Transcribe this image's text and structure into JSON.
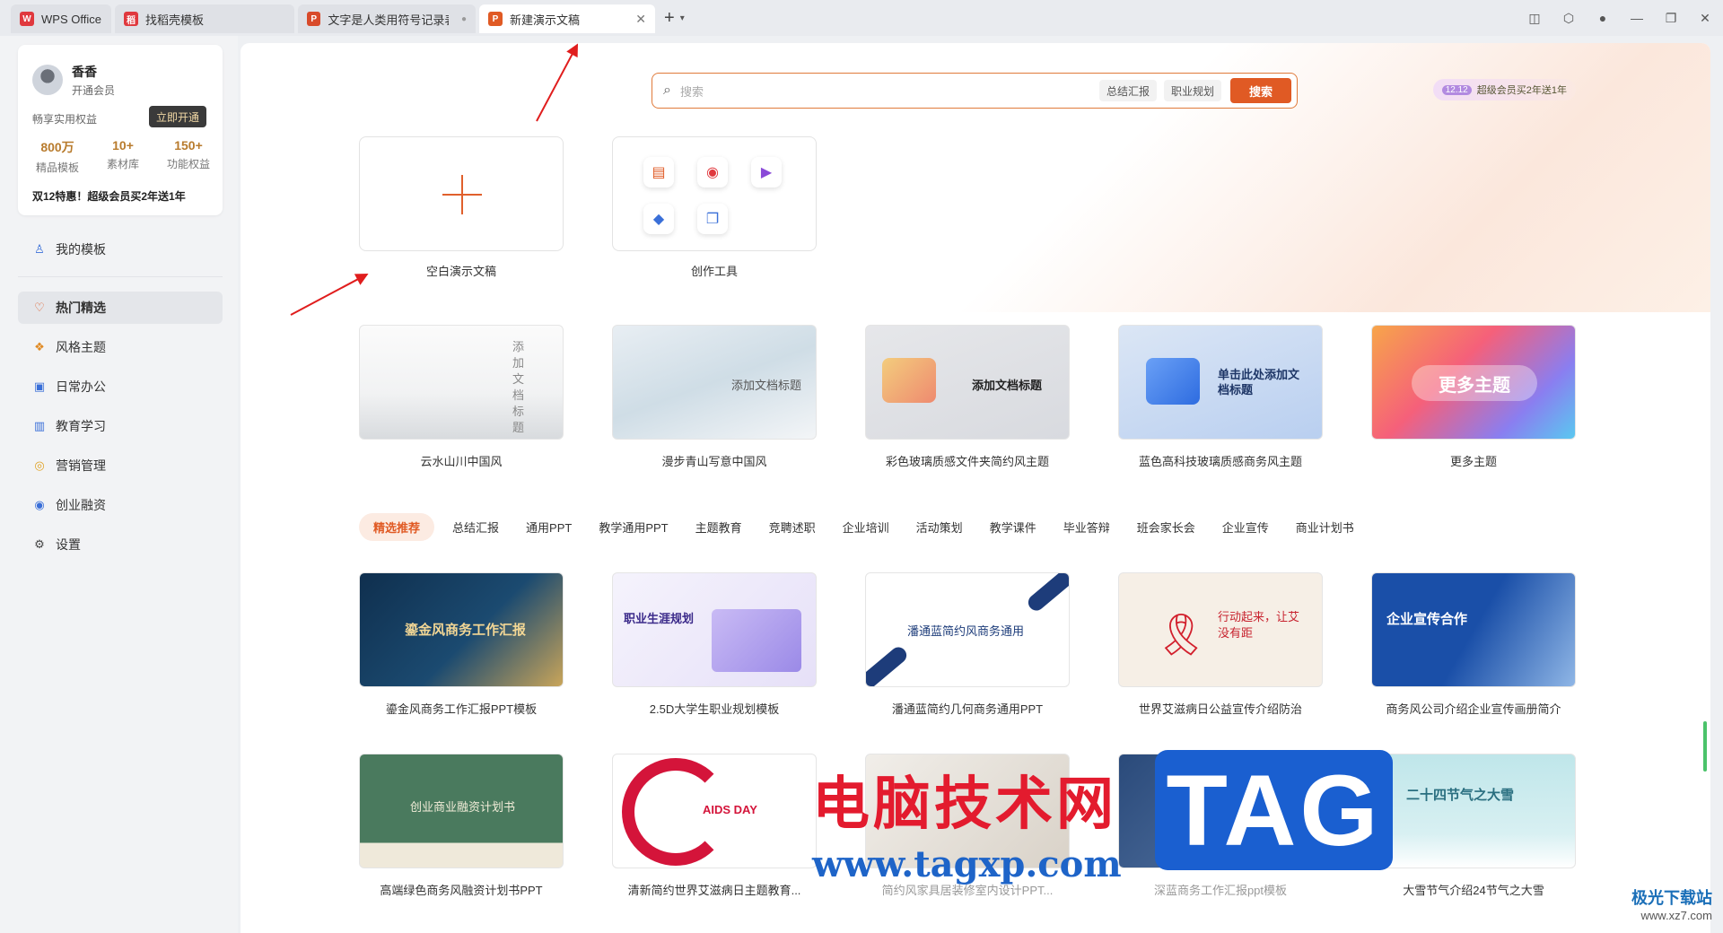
{
  "tabs": [
    {
      "label": "WPS Office",
      "color": "#e0393e",
      "glyph": "W"
    },
    {
      "label": "找稻壳模板",
      "color": "#e0393e",
      "glyph": "稻"
    },
    {
      "label": "文字是人类用符号记录表达信息以",
      "color": "#d84a2a",
      "glyph": "P"
    },
    {
      "label": "新建演示文稿",
      "color": "#e05a24",
      "glyph": "P"
    }
  ],
  "tab_add": "+",
  "user": {
    "name": "香香",
    "sub": "开通会员",
    "benefit_label": "畅享实用权益",
    "open_button": "立即开通",
    "stats": [
      {
        "num": "800万",
        "label": "精品模板"
      },
      {
        "num": "10+",
        "label": "素材库"
      },
      {
        "num": "150+",
        "label": "功能权益"
      }
    ],
    "promo": "双12特惠！超级会员买2年送1年"
  },
  "nav": {
    "my_templates": "我的模板",
    "items": [
      {
        "label": "热门精选",
        "icon": "heart-icon",
        "active": true
      },
      {
        "label": "风格主题",
        "icon": "grid-icon"
      },
      {
        "label": "日常办公",
        "icon": "monitor-icon"
      },
      {
        "label": "教育学习",
        "icon": "book-icon"
      },
      {
        "label": "营销管理",
        "icon": "target-icon"
      },
      {
        "label": "创业融资",
        "icon": "coin-icon"
      },
      {
        "label": "设置",
        "icon": "gear-icon"
      }
    ]
  },
  "search": {
    "placeholder": "搜索",
    "chips": [
      "总结汇报",
      "职业规划"
    ],
    "button": "搜索"
  },
  "vip_badge": {
    "tag": "12.12",
    "text": "超级会员买2年送1年"
  },
  "quick": {
    "blank_label": "空白演示文稿",
    "tools_label": "创作工具"
  },
  "themes": [
    {
      "label": "云水山川中国风",
      "title": "添加文档标题"
    },
    {
      "label": "漫步青山写意中国风",
      "title": "添加文档标题"
    },
    {
      "label": "彩色玻璃质感文件夹简约风主题",
      "title": "添加文档标题"
    },
    {
      "label": "蓝色高科技玻璃质感商务风主题",
      "title": "单击此处添加文档标题"
    },
    {
      "label": "更多主题",
      "title": "更多主题"
    }
  ],
  "categories": [
    "精选推荐",
    "总结汇报",
    "通用PPT",
    "教学通用PPT",
    "主题教育",
    "竞聘述职",
    "企业培训",
    "活动策划",
    "教学课件",
    "毕业答辩",
    "班会家长会",
    "企业宣传",
    "商业计划书"
  ],
  "templates_row1": [
    {
      "label": "鎏金风商务工作汇报PPT模板",
      "title": "鎏金风商务工作汇报"
    },
    {
      "label": "2.5D大学生职业规划模板",
      "title": "职业生涯规划"
    },
    {
      "label": "潘通蓝简约几何商务通用PPT",
      "title": "潘通蓝简约风商务通用"
    },
    {
      "label": "世界艾滋病日公益宣传介绍防治",
      "title": "行动起来，让艾没有距"
    },
    {
      "label": "商务风公司介绍企业宣传画册简介",
      "title": "企业宣传合作"
    }
  ],
  "templates_row2": [
    {
      "label": "高端绿色商务风融资计划书PPT",
      "title": "创业商业融资计划书"
    },
    {
      "label": "清新简约世界艾滋病日主题教育...",
      "title": "AIDS DAY"
    },
    {
      "label": "简约风家具居装修室内设计PPT...",
      "title": ""
    },
    {
      "label": "深蓝商务工作汇报ppt模板",
      "title": ""
    },
    {
      "label": "大雪节气介绍24节气之大雪",
      "title": "二十四节气之大雪"
    }
  ],
  "watermark": {
    "cn": "电脑技术网",
    "url": "www.tagxp.com",
    "tag": "TAG",
    "corner": "极光下载站",
    "corner_url": "www.xz7.com"
  },
  "colors": {
    "accent": "#e05a24",
    "arrow": "#e01d1d"
  }
}
